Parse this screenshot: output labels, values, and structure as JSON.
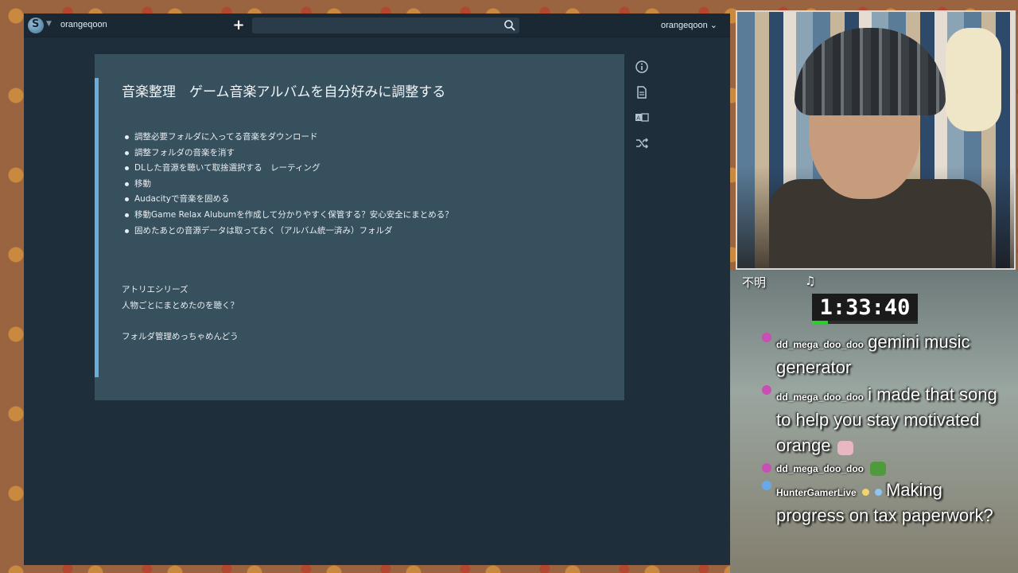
{
  "app": {
    "workspace_name": "orangeqoon",
    "user_menu_label": "orangeqoon ⌄",
    "search": {
      "value": "",
      "placeholder": ""
    }
  },
  "note": {
    "title": "音楽整理　ゲーム音楽アルバムを自分好みに調整する",
    "bullets": [
      "調整必要フォルダに入ってる音楽をダウンロード",
      "調整フォルダの音楽を消す",
      "DLした音源を聴いて取捨選択する　レーティング",
      "移動",
      "Audacityで音楽を固める",
      "移動Game Relax Alubumを作成して分かりやすく保管する？安心安全にまとめる？",
      "固めたあとの音源データは取っておく（アルバム統一済み）フォルダ"
    ],
    "lines": [
      "アトリエシリーズ",
      "人物ごとにまとめたのを聴く？",
      "フォルダ管理めっちゃめんどう"
    ]
  },
  "side_tools": [
    "info-icon",
    "document-icon",
    "translate-icon",
    "shuffle-icon"
  ],
  "stream": {
    "song_status": "不明",
    "song_icon": "♫",
    "timer": "1:33:40",
    "timer_progress": 0.15,
    "chat": [
      {
        "user": "dd_mega_doo_doo",
        "text": "gemini music generator",
        "badge_color": "#c84fb4",
        "emote": ""
      },
      {
        "user": "dd_mega_doo_doo",
        "text": "i made that song to help you stay motivated orange",
        "badge_color": "#c84fb4",
        "emote": "cat-emote"
      },
      {
        "user": "dd_mega_doo_doo",
        "text": "",
        "badge_color": "#c84fb4",
        "emote": "pepe-emote"
      },
      {
        "user": "HunterGamerLive",
        "text": "Making progress on tax paperwork?",
        "badge_color": "#6aa9e8",
        "emote": ""
      }
    ]
  },
  "colors": {
    "app_bg": "#1e2e3a",
    "topbar_bg": "#1a2833",
    "note_bg": "#37505e",
    "accent": "#6aaedc",
    "timer_green": "#27d12a"
  }
}
